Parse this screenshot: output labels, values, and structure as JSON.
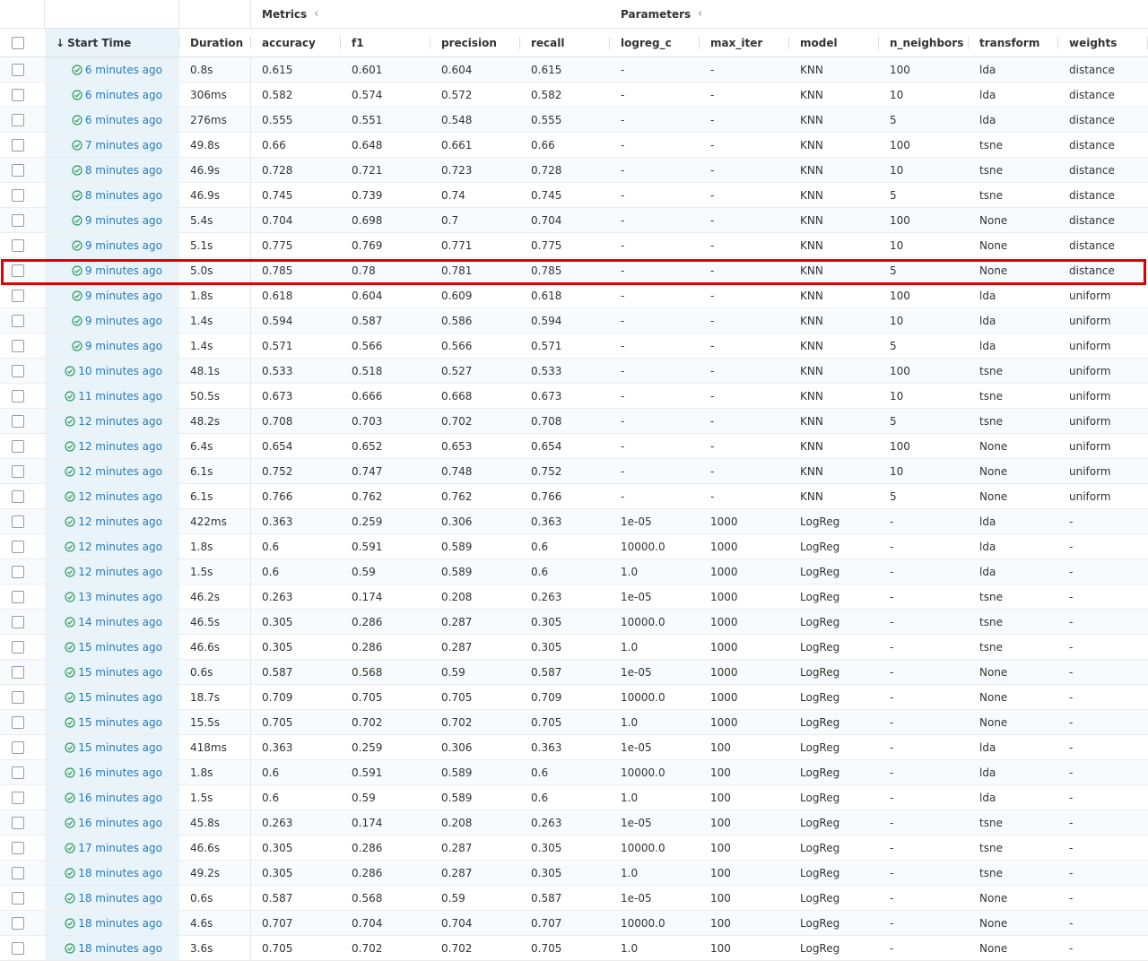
{
  "header": {
    "groups": {
      "metrics": "Metrics",
      "parameters": "Parameters"
    },
    "columns": {
      "start_time": "Start Time",
      "duration": "Duration",
      "accuracy": "accuracy",
      "f1": "f1",
      "precision": "precision",
      "recall": "recall",
      "logreg_c": "logreg_c",
      "max_iter": "max_iter",
      "model": "model",
      "n_neighbors": "n_neighbors",
      "transform": "transform",
      "weights": "weights"
    }
  },
  "highlighted_row_index": 8,
  "colors": {
    "link": "#2b7bb9",
    "success": "#2e9d5a",
    "highlight_border": "#e00000",
    "start_time_bg": "#e8f3fa"
  },
  "rows": [
    [
      "6 minutes ago",
      "0.8s",
      "0.615",
      "0.601",
      "0.604",
      "0.615",
      "-",
      "-",
      "KNN",
      "100",
      "lda",
      "distance"
    ],
    [
      "6 minutes ago",
      "306ms",
      "0.582",
      "0.574",
      "0.572",
      "0.582",
      "-",
      "-",
      "KNN",
      "10",
      "lda",
      "distance"
    ],
    [
      "6 minutes ago",
      "276ms",
      "0.555",
      "0.551",
      "0.548",
      "0.555",
      "-",
      "-",
      "KNN",
      "5",
      "lda",
      "distance"
    ],
    [
      "7 minutes ago",
      "49.8s",
      "0.66",
      "0.648",
      "0.661",
      "0.66",
      "-",
      "-",
      "KNN",
      "100",
      "tsne",
      "distance"
    ],
    [
      "8 minutes ago",
      "46.9s",
      "0.728",
      "0.721",
      "0.723",
      "0.728",
      "-",
      "-",
      "KNN",
      "10",
      "tsne",
      "distance"
    ],
    [
      "8 minutes ago",
      "46.9s",
      "0.745",
      "0.739",
      "0.74",
      "0.745",
      "-",
      "-",
      "KNN",
      "5",
      "tsne",
      "distance"
    ],
    [
      "9 minutes ago",
      "5.4s",
      "0.704",
      "0.698",
      "0.7",
      "0.704",
      "-",
      "-",
      "KNN",
      "100",
      "None",
      "distance"
    ],
    [
      "9 minutes ago",
      "5.1s",
      "0.775",
      "0.769",
      "0.771",
      "0.775",
      "-",
      "-",
      "KNN",
      "10",
      "None",
      "distance"
    ],
    [
      "9 minutes ago",
      "5.0s",
      "0.785",
      "0.78",
      "0.781",
      "0.785",
      "-",
      "-",
      "KNN",
      "5",
      "None",
      "distance"
    ],
    [
      "9 minutes ago",
      "1.8s",
      "0.618",
      "0.604",
      "0.609",
      "0.618",
      "-",
      "-",
      "KNN",
      "100",
      "lda",
      "uniform"
    ],
    [
      "9 minutes ago",
      "1.4s",
      "0.594",
      "0.587",
      "0.586",
      "0.594",
      "-",
      "-",
      "KNN",
      "10",
      "lda",
      "uniform"
    ],
    [
      "9 minutes ago",
      "1.4s",
      "0.571",
      "0.566",
      "0.566",
      "0.571",
      "-",
      "-",
      "KNN",
      "5",
      "lda",
      "uniform"
    ],
    [
      "10 minutes ago",
      "48.1s",
      "0.533",
      "0.518",
      "0.527",
      "0.533",
      "-",
      "-",
      "KNN",
      "100",
      "tsne",
      "uniform"
    ],
    [
      "11 minutes ago",
      "50.5s",
      "0.673",
      "0.666",
      "0.668",
      "0.673",
      "-",
      "-",
      "KNN",
      "10",
      "tsne",
      "uniform"
    ],
    [
      "12 minutes ago",
      "48.2s",
      "0.708",
      "0.703",
      "0.702",
      "0.708",
      "-",
      "-",
      "KNN",
      "5",
      "tsne",
      "uniform"
    ],
    [
      "12 minutes ago",
      "6.4s",
      "0.654",
      "0.652",
      "0.653",
      "0.654",
      "-",
      "-",
      "KNN",
      "100",
      "None",
      "uniform"
    ],
    [
      "12 minutes ago",
      "6.1s",
      "0.752",
      "0.747",
      "0.748",
      "0.752",
      "-",
      "-",
      "KNN",
      "10",
      "None",
      "uniform"
    ],
    [
      "12 minutes ago",
      "6.1s",
      "0.766",
      "0.762",
      "0.762",
      "0.766",
      "-",
      "-",
      "KNN",
      "5",
      "None",
      "uniform"
    ],
    [
      "12 minutes ago",
      "422ms",
      "0.363",
      "0.259",
      "0.306",
      "0.363",
      "1e-05",
      "1000",
      "LogReg",
      "-",
      "lda",
      "-"
    ],
    [
      "12 minutes ago",
      "1.8s",
      "0.6",
      "0.591",
      "0.589",
      "0.6",
      "10000.0",
      "1000",
      "LogReg",
      "-",
      "lda",
      "-"
    ],
    [
      "12 minutes ago",
      "1.5s",
      "0.6",
      "0.59",
      "0.589",
      "0.6",
      "1.0",
      "1000",
      "LogReg",
      "-",
      "lda",
      "-"
    ],
    [
      "13 minutes ago",
      "46.2s",
      "0.263",
      "0.174",
      "0.208",
      "0.263",
      "1e-05",
      "1000",
      "LogReg",
      "-",
      "tsne",
      "-"
    ],
    [
      "14 minutes ago",
      "46.5s",
      "0.305",
      "0.286",
      "0.287",
      "0.305",
      "10000.0",
      "1000",
      "LogReg",
      "-",
      "tsne",
      "-"
    ],
    [
      "15 minutes ago",
      "46.6s",
      "0.305",
      "0.286",
      "0.287",
      "0.305",
      "1.0",
      "1000",
      "LogReg",
      "-",
      "tsne",
      "-"
    ],
    [
      "15 minutes ago",
      "0.6s",
      "0.587",
      "0.568",
      "0.59",
      "0.587",
      "1e-05",
      "1000",
      "LogReg",
      "-",
      "None",
      "-"
    ],
    [
      "15 minutes ago",
      "18.7s",
      "0.709",
      "0.705",
      "0.705",
      "0.709",
      "10000.0",
      "1000",
      "LogReg",
      "-",
      "None",
      "-"
    ],
    [
      "15 minutes ago",
      "15.5s",
      "0.705",
      "0.702",
      "0.702",
      "0.705",
      "1.0",
      "1000",
      "LogReg",
      "-",
      "None",
      "-"
    ],
    [
      "15 minutes ago",
      "418ms",
      "0.363",
      "0.259",
      "0.306",
      "0.363",
      "1e-05",
      "100",
      "LogReg",
      "-",
      "lda",
      "-"
    ],
    [
      "16 minutes ago",
      "1.8s",
      "0.6",
      "0.591",
      "0.589",
      "0.6",
      "10000.0",
      "100",
      "LogReg",
      "-",
      "lda",
      "-"
    ],
    [
      "16 minutes ago",
      "1.5s",
      "0.6",
      "0.59",
      "0.589",
      "0.6",
      "1.0",
      "100",
      "LogReg",
      "-",
      "lda",
      "-"
    ],
    [
      "16 minutes ago",
      "45.8s",
      "0.263",
      "0.174",
      "0.208",
      "0.263",
      "1e-05",
      "100",
      "LogReg",
      "-",
      "tsne",
      "-"
    ],
    [
      "17 minutes ago",
      "46.6s",
      "0.305",
      "0.286",
      "0.287",
      "0.305",
      "10000.0",
      "100",
      "LogReg",
      "-",
      "tsne",
      "-"
    ],
    [
      "18 minutes ago",
      "49.2s",
      "0.305",
      "0.286",
      "0.287",
      "0.305",
      "1.0",
      "100",
      "LogReg",
      "-",
      "tsne",
      "-"
    ],
    [
      "18 minutes ago",
      "0.6s",
      "0.587",
      "0.568",
      "0.59",
      "0.587",
      "1e-05",
      "100",
      "LogReg",
      "-",
      "None",
      "-"
    ],
    [
      "18 minutes ago",
      "4.6s",
      "0.707",
      "0.704",
      "0.704",
      "0.707",
      "10000.0",
      "100",
      "LogReg",
      "-",
      "None",
      "-"
    ],
    [
      "18 minutes ago",
      "3.6s",
      "0.705",
      "0.702",
      "0.702",
      "0.705",
      "1.0",
      "100",
      "LogReg",
      "-",
      "None",
      "-"
    ]
  ]
}
